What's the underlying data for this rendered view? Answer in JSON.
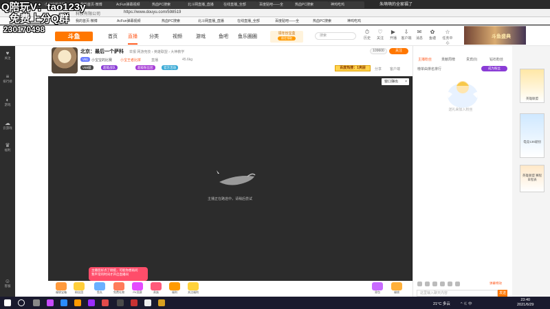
{
  "overlay": {
    "line1": "Q陪玩V：tao123y",
    "line2": "免费上分Q群",
    "line3": "230170498"
  },
  "browser": {
    "tabs": [
      "西德-一天",
      "小宝宝的主播",
      "我的首页·微博",
      "AcFun弹幕视频",
      "热血PC搜索",
      "北斗网直播_直播",
      "在线直播_全部",
      "百度贴吧——全",
      "热血PC搜索",
      "神鸡吃鸡"
    ],
    "active_tab_title": "朱萌萌的全家福了",
    "company": "科技有限公司",
    "url": "https://www.douyu.com/598519"
  },
  "header": {
    "logo": "斗鱼",
    "nav": [
      "首页",
      "直播",
      "分类",
      "视频",
      "游戏",
      "鱼吧",
      "鱼乐圈圈"
    ],
    "promo_text": "领年份宝盒",
    "promo_btn": "前往领取",
    "search_placeholder": "搜索",
    "icons": [
      {
        "label": "历史",
        "glyph": "⏱"
      },
      {
        "label": "关注",
        "glyph": "♡"
      },
      {
        "label": "开播",
        "glyph": "▶"
      },
      {
        "label": "客户端",
        "glyph": "⇩"
      },
      {
        "label": "消息",
        "glyph": "✉"
      },
      {
        "label": "鱼塘",
        "glyph": "✿"
      },
      {
        "label": "任务中心",
        "glyph": "☆"
      }
    ],
    "banner_text": "斗鱼盛典"
  },
  "sidebar": {
    "items": [
      {
        "label": "关注",
        "glyph": "♥"
      },
      {
        "label": "排行榜",
        "glyph": "≡"
      },
      {
        "label": "游戏",
        "glyph": "◐"
      },
      {
        "label": "云游戏",
        "glyph": "☁"
      },
      {
        "label": "福利",
        "glyph": "♛"
      },
      {
        "label": "客服",
        "glyph": "☺"
      }
    ]
  },
  "room": {
    "title": "北京：最后一个萨科",
    "category_path": "举报  网游竞技 › 英雄联盟 › 大神教学",
    "level": "V81",
    "streamer": "小宝宝的比赛",
    "hot": "小宝王者比拼",
    "hot2": "直播",
    "fans": "45.6kg",
    "fan_count": "109600",
    "follow_label": "关注",
    "rank_badge": "百度热搜：1夹层",
    "badges": [
      "V88级",
      "超能战队",
      "超级粉丝团",
      "官方活动"
    ],
    "actions": [
      "分享",
      "客户端"
    ]
  },
  "video": {
    "popout_label": "窗口弹出",
    "status_text": "主播正在路途中，请稍后尝试"
  },
  "bubble": {
    "line1": "主播您好点了刚提，可能你想再问",
    "line2": "我平常的时间才开启直播间"
  },
  "gifts": [
    {
      "label": "福袋宝箱",
      "color": "#ff9a3c"
    },
    {
      "label": "粉丝团",
      "color": "#ffcf3a"
    },
    {
      "label": "鱼丸",
      "color": "#6ab0ff"
    },
    {
      "label": "免费礼物",
      "color": "#ff7b5a"
    },
    {
      "label": "PK竞赛",
      "color": "#e44bff"
    },
    {
      "label": "贵族",
      "color": "#ff5a7a"
    },
    {
      "label": "福利",
      "color": "#ff9a00"
    },
    {
      "label": "关注福利",
      "color": "#ffd23a"
    },
    {
      "label": "乐乐大赛",
      "color": "#6ad0ff"
    },
    {
      "label": "背包",
      "color": "#c86bff"
    },
    {
      "label": "福袋",
      "color": "#ffb03a"
    }
  ],
  "rpanel": {
    "tabs": [
      "主播粉丝",
      "贡献周榜",
      "贵宾(0)",
      "钻石粉丝"
    ],
    "rank_label": "榜单由排名排行",
    "become_btn": "成为粉丝",
    "angel_caption": "送礼来加入粉丝",
    "danmu_label": "弹幕特效",
    "chat_placeholder": "这里输入聊天内容",
    "send_label": "发送"
  },
  "farright": {
    "cards": [
      "英雄联盟",
      "电竞135级别",
      "英雄联盟 赛程日程表"
    ]
  },
  "taskbar": {
    "weather": "21°C 多云",
    "tray": "^ ㄍ 中",
    "time": "23:40",
    "date": "2021/6/29"
  }
}
